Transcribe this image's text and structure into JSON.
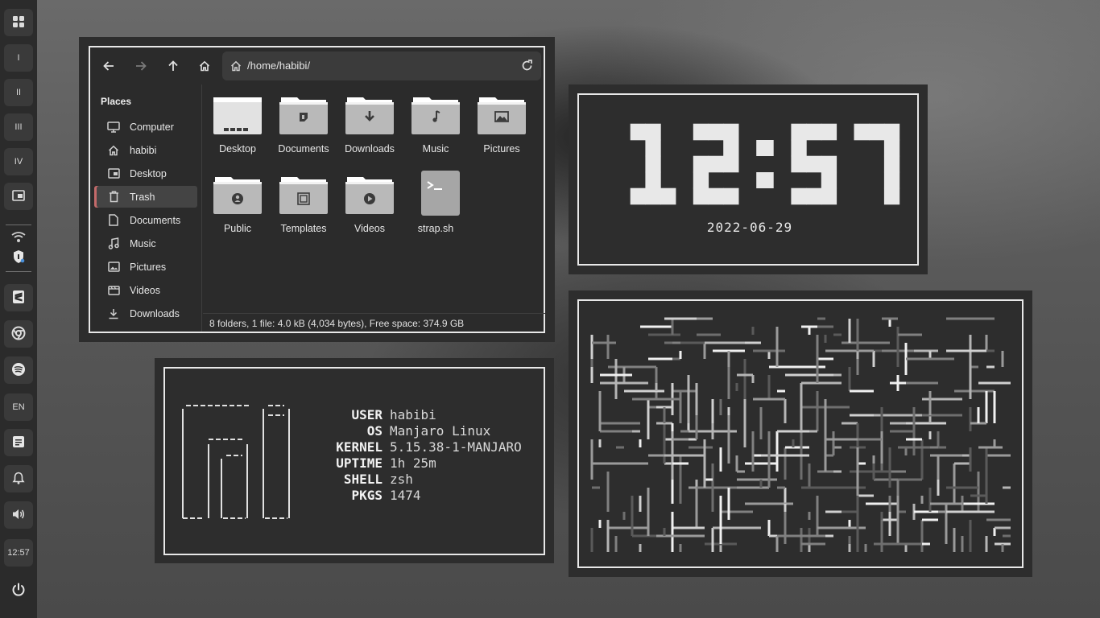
{
  "dock": {
    "workspaces": [
      "I",
      "II",
      "III",
      "IV"
    ],
    "language": "EN",
    "time": "12:57"
  },
  "file_manager": {
    "path": "/home/habibi/",
    "sidebar": {
      "title": "Places",
      "items": [
        {
          "label": "Computer",
          "icon": "monitor-icon"
        },
        {
          "label": "habibi",
          "icon": "home-icon"
        },
        {
          "label": "Desktop",
          "icon": "desktop-icon"
        },
        {
          "label": "Trash",
          "icon": "trash-icon",
          "active": true
        },
        {
          "label": "Documents",
          "icon": "document-icon"
        },
        {
          "label": "Music",
          "icon": "music-icon"
        },
        {
          "label": "Pictures",
          "icon": "picture-icon"
        },
        {
          "label": "Videos",
          "icon": "video-icon"
        },
        {
          "label": "Downloads",
          "icon": "download-icon"
        }
      ]
    },
    "files": [
      {
        "label": "Desktop",
        "icon": "desktop-folder-icon"
      },
      {
        "label": "Documents",
        "icon": "documents-folder-icon"
      },
      {
        "label": "Downloads",
        "icon": "downloads-folder-icon"
      },
      {
        "label": "Music",
        "icon": "music-folder-icon"
      },
      {
        "label": "Pictures",
        "icon": "pictures-folder-icon"
      },
      {
        "label": "Public",
        "icon": "public-folder-icon"
      },
      {
        "label": "Templates",
        "icon": "templates-folder-icon"
      },
      {
        "label": "Videos",
        "icon": "videos-folder-icon"
      },
      {
        "label": "strap.sh",
        "icon": "terminal-script-icon"
      }
    ],
    "status": "8 folders, 1 file: 4.0 kB (4,034 bytes), Free space: 374.9 GB"
  },
  "clock": {
    "time": "12:57",
    "date": "2022-06-29"
  },
  "fetch": {
    "rows": [
      {
        "key": "USER",
        "value": "habibi"
      },
      {
        "key": "OS",
        "value": "Manjaro Linux"
      },
      {
        "key": "KERNEL",
        "value": "5.15.38-1-MANJARO"
      },
      {
        "key": "UPTIME",
        "value": "1h 25m"
      },
      {
        "key": "SHELL",
        "value": "zsh"
      },
      {
        "key": "PKGS",
        "value": "1474"
      }
    ]
  },
  "colors": {
    "panel": "#2d2d2d",
    "border": "#e8e8e8",
    "dock": "#2b2b2b",
    "trash_accent": "#c46a6a"
  }
}
